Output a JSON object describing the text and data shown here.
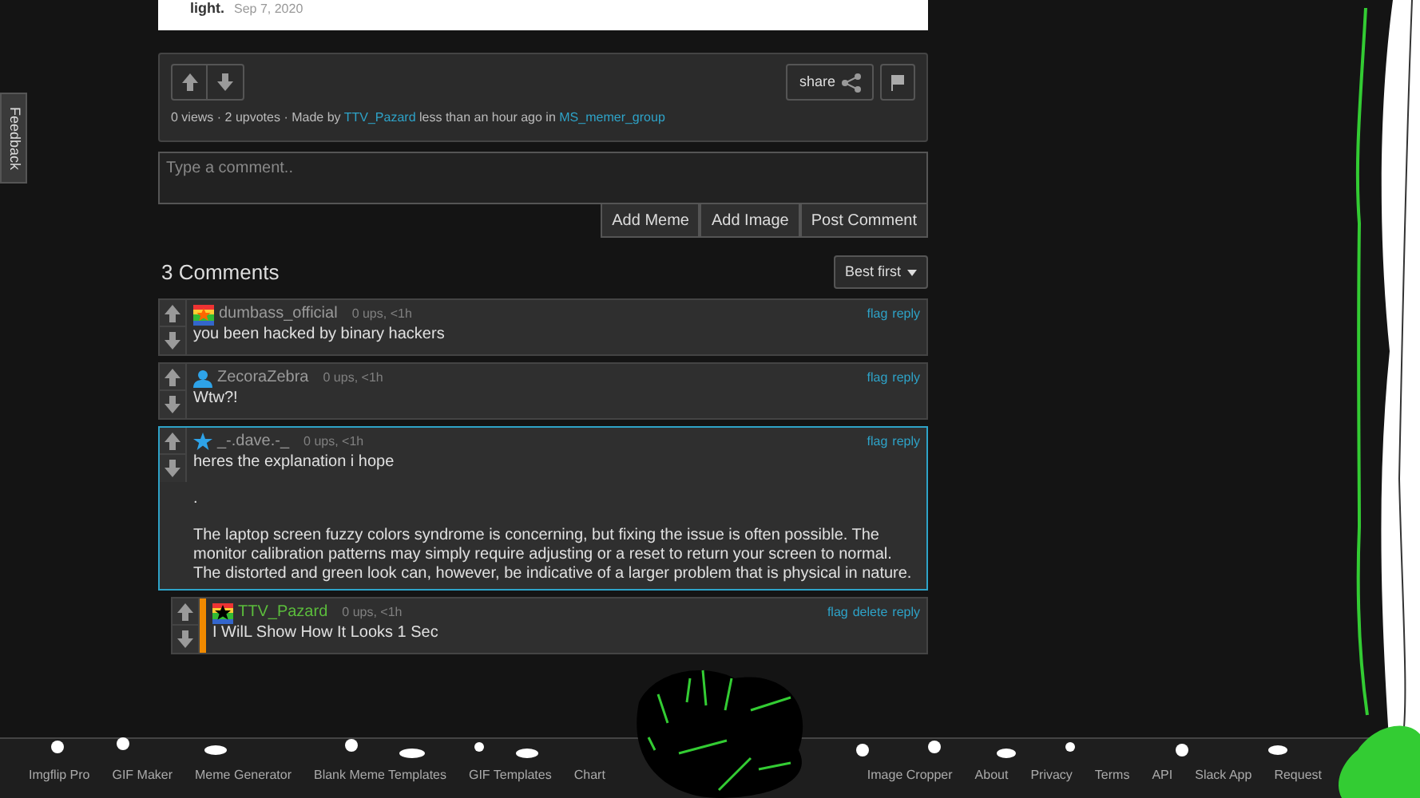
{
  "image": {
    "caption": "light.",
    "date": "Sep 7, 2020"
  },
  "feedback_tab": {
    "label": "Feedback"
  },
  "post": {
    "made_by": "0 views · 2 upvotes · Made by",
    "author": "TTV_Pazard",
    "time": "less than an hour ago in",
    "group": "MS_memer_group",
    "share": "share"
  },
  "comment_box": {
    "placeholder": "Type a comment..",
    "buttons": [
      "Add Meme",
      "Add Image",
      "Post Comment"
    ]
  },
  "comments_header": {
    "title": "3 Comments",
    "sort": "Best first"
  },
  "comments": [
    {
      "user": "dumbass_official",
      "avatar": {
        "kind": "rainbow"
      },
      "op": false,
      "selected": false,
      "meta": "0 ups, <1h",
      "actions": [
        "flag",
        "reply"
      ],
      "paragraphs": [
        "you been hacked by binary hackers"
      ]
    },
    {
      "user": "ZecoraZebra",
      "avatar": {
        "kind": "person"
      },
      "op": false,
      "selected": false,
      "meta": "0 ups, <1h",
      "actions": [
        "flag",
        "reply"
      ],
      "paragraphs": [
        "Wtw?!"
      ]
    },
    {
      "user": "_-.dave.-_",
      "avatar": {
        "kind": "star"
      },
      "op": false,
      "selected": true,
      "meta": "0 ups, <1h",
      "actions": [
        "flag",
        "reply"
      ],
      "paragraphs": [
        "heres the explanation i hope",
        ".",
        "The laptop screen fuzzy colors syndrome is concerning, but fixing the issue is often possible. The monitor calibration patterns may simply require adjusting or a reset to return your screen to normal. The distorted and green look can, however, be indicative of a larger problem that is physical in nature."
      ],
      "children": [
        {
          "user": "TTV_Pazard",
          "avatar": {
            "kind": "rainbow-star"
          },
          "op": true,
          "selected": false,
          "meta": "0 ups, <1h",
          "actions": [
            "flag",
            "delete",
            "reply"
          ],
          "paragraphs": [
            "I WilL Show How It Looks 1 Sec"
          ]
        }
      ]
    }
  ],
  "footer": [
    "Imgflip Pro",
    "GIF Maker",
    "Meme Generator",
    "Blank Meme Templates",
    "GIF Templates",
    "Chart",
    "Image Cropper",
    "About",
    "Privacy",
    "Terms",
    "API",
    "Slack App",
    "Request"
  ]
}
